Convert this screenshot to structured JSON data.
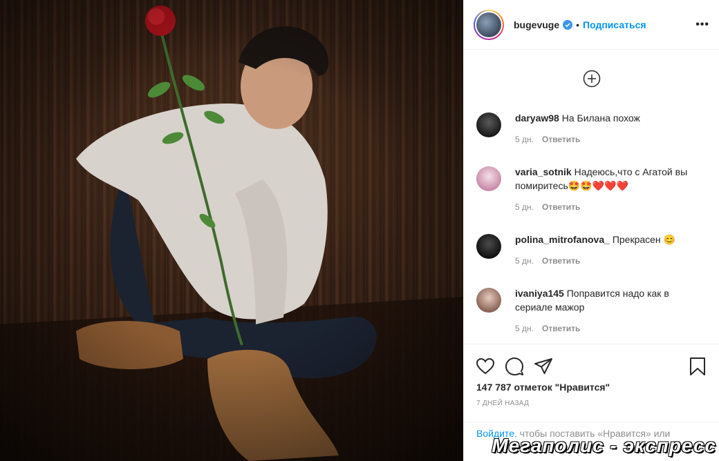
{
  "post": {
    "image_alt_icon": "photo",
    "header": {
      "username": "bugevuge",
      "separator": "•",
      "follow_label": "Подписаться",
      "more_icon": "•••"
    },
    "comments": [
      {
        "user": "daryaw98",
        "text": "На Билана похож",
        "time": "5 дн.",
        "reply": "Ответить",
        "avatar_color": "#2b2b2b"
      },
      {
        "user": "varia_sotnik",
        "text": "Надеюсь,что с Агатой вы помиритесь🤩🤩❤️❤️❤️",
        "time": "5 дн.",
        "reply": "Ответить",
        "avatar_color": "#c98aa8"
      },
      {
        "user": "polina_mitrofanova_",
        "text": "Прекрасен 😊",
        "time": "5 дн.",
        "reply": "Ответить",
        "avatar_color": "#1f1f1f"
      },
      {
        "user": "ivaniya145",
        "text": "Поправится надо как в сериале мажор",
        "time": "5 дн.",
        "reply": "Ответить",
        "avatar_color": "#b48a78"
      }
    ],
    "likes": "147 787 отметок \"Нравится\"",
    "date": "7 ДНЕЙ НАЗАД",
    "login_link": "Войдите",
    "login_rest": ", чтобы поставить «Нравится» или"
  },
  "watermark": "Мегаполис - экспресс",
  "colors": {
    "accent": "#0095f6",
    "text": "#262626",
    "muted": "#8e8e8e",
    "border": "#efefef"
  }
}
